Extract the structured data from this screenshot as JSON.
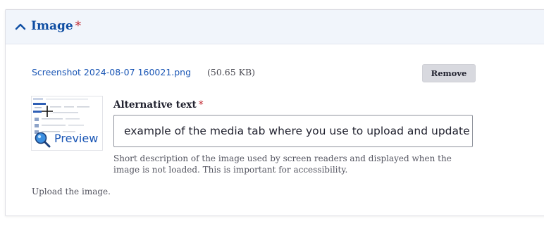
{
  "field": {
    "title": "Image",
    "required_marker": "*"
  },
  "file": {
    "name": "Screenshot 2024-08-07 160021.png",
    "size": "(50.65 KB)"
  },
  "remove_button": {
    "label": "Remove"
  },
  "thumbnail": {
    "preview_label": "Preview",
    "preview_icon": "magnifier-icon",
    "move_icon": "crosshair-icon"
  },
  "alt_text": {
    "label": "Alternative text",
    "required_marker": "*",
    "value": "example of the media tab where you use to upload and update fi",
    "description": "Short description of the image used by screen readers and displayed when the image is not loaded. This is important for accessibility."
  },
  "upload_description": "Upload the image.",
  "colors": {
    "accent": "#0f4ea3",
    "link": "#1a56b5",
    "required": "#c1262f",
    "header_bg": "#f1f5fb",
    "button_bg": "#d8d9df"
  }
}
